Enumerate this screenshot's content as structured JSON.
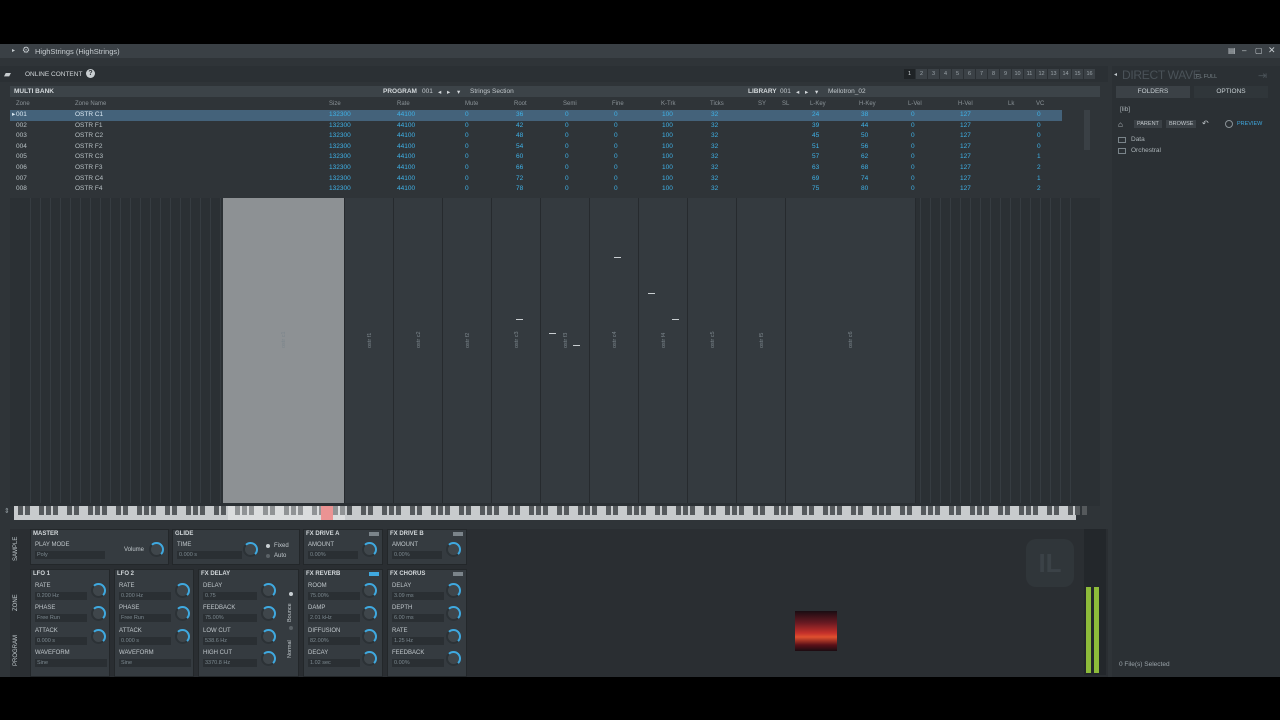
{
  "window": {
    "title": "HighStrings (HighStrings)"
  },
  "topbar": {
    "online_content": "ONLINE CONTENT",
    "tabs": [
      "1",
      "2",
      "3",
      "4",
      "5",
      "6",
      "7",
      "8",
      "9",
      "10",
      "11",
      "12",
      "13",
      "14",
      "15",
      "16"
    ]
  },
  "header": {
    "multi_bank": "MULTI BANK",
    "program_label": "PROGRAM",
    "program_num": "001",
    "program_name": "Strings Section",
    "library_label": "LIBRARY",
    "library_num": "001",
    "library_name": "Mellotron_02"
  },
  "columns": [
    "Zone",
    "Zone Name",
    "Size",
    "Rate",
    "Mute",
    "Root",
    "Semi",
    "Fine",
    "K-Trk",
    "Ticks",
    "SY",
    "SL",
    "L-Key",
    "H-Key",
    "L-Vel",
    "H-Vel",
    "Lk",
    "VC"
  ],
  "zones": [
    {
      "zone": "001",
      "name": "OSTR C1",
      "size": "132300",
      "rate": "44100",
      "mute": "0",
      "root": "36",
      "semi": "0",
      "fine": "0",
      "ktrk": "100",
      "ticks": "32",
      "lkey": "24",
      "hkey": "38",
      "lvel": "0",
      "hvel": "127",
      "vc": "0"
    },
    {
      "zone": "002",
      "name": "OSTR F1",
      "size": "132300",
      "rate": "44100",
      "mute": "0",
      "root": "42",
      "semi": "0",
      "fine": "0",
      "ktrk": "100",
      "ticks": "32",
      "lkey": "39",
      "hkey": "44",
      "lvel": "0",
      "hvel": "127",
      "vc": "0"
    },
    {
      "zone": "003",
      "name": "OSTR C2",
      "size": "132300",
      "rate": "44100",
      "mute": "0",
      "root": "48",
      "semi": "0",
      "fine": "0",
      "ktrk": "100",
      "ticks": "32",
      "lkey": "45",
      "hkey": "50",
      "lvel": "0",
      "hvel": "127",
      "vc": "0"
    },
    {
      "zone": "004",
      "name": "OSTR F2",
      "size": "132300",
      "rate": "44100",
      "mute": "0",
      "root": "54",
      "semi": "0",
      "fine": "0",
      "ktrk": "100",
      "ticks": "32",
      "lkey": "51",
      "hkey": "56",
      "lvel": "0",
      "hvel": "127",
      "vc": "0"
    },
    {
      "zone": "005",
      "name": "OSTR C3",
      "size": "132300",
      "rate": "44100",
      "mute": "0",
      "root": "60",
      "semi": "0",
      "fine": "0",
      "ktrk": "100",
      "ticks": "32",
      "lkey": "57",
      "hkey": "62",
      "lvel": "0",
      "hvel": "127",
      "vc": "1"
    },
    {
      "zone": "006",
      "name": "OSTR F3",
      "size": "132300",
      "rate": "44100",
      "mute": "0",
      "root": "66",
      "semi": "0",
      "fine": "0",
      "ktrk": "100",
      "ticks": "32",
      "lkey": "63",
      "hkey": "68",
      "lvel": "0",
      "hvel": "127",
      "vc": "2"
    },
    {
      "zone": "007",
      "name": "OSTR C4",
      "size": "132300",
      "rate": "44100",
      "mute": "0",
      "root": "72",
      "semi": "0",
      "fine": "0",
      "ktrk": "100",
      "ticks": "32",
      "lkey": "69",
      "hkey": "74",
      "lvel": "0",
      "hvel": "127",
      "vc": "1"
    },
    {
      "zone": "008",
      "name": "OSTR F4",
      "size": "132300",
      "rate": "44100",
      "mute": "0",
      "root": "78",
      "semi": "0",
      "fine": "0",
      "ktrk": "100",
      "ticks": "32",
      "lkey": "75",
      "hkey": "80",
      "lvel": "0",
      "hvel": "127",
      "vc": "2"
    }
  ],
  "zonemap_labels": [
    "ostr c1",
    "ostr f1",
    "ostr c2",
    "ostr f2",
    "ostr c3",
    "ostr f3",
    "ostr c4",
    "ostr f4",
    "ostr c5",
    "ostr f5",
    "ostr c6"
  ],
  "vtabs": [
    "SAMPLE",
    "ZONE",
    "PROGRAM"
  ],
  "master": {
    "title": "MASTER",
    "play_mode": "PLAY MODE",
    "play_mode_val": "Poly",
    "volume": "Volume"
  },
  "glide": {
    "title": "GLIDE",
    "time": "TIME",
    "time_val": "0.000 s",
    "fixed": "Fixed",
    "auto": "Auto"
  },
  "drive_a": {
    "title": "FX DRIVE A",
    "amount": "AMOUNT",
    "amount_val": "0.00%"
  },
  "drive_b": {
    "title": "FX DRIVE B",
    "amount": "AMOUNT",
    "amount_val": "0.00%"
  },
  "lfo1": {
    "title": "LFO 1",
    "rate": "RATE",
    "rate_val": "0.200 Hz",
    "phase": "PHASE",
    "phase_val": "Free Run",
    "attack": "ATTACK",
    "attack_val": "0.000 s",
    "waveform": "WAVEFORM",
    "waveform_val": "Sine"
  },
  "lfo2": {
    "title": "LFO 2",
    "rate": "RATE",
    "rate_val": "0.200 Hz",
    "phase": "PHASE",
    "phase_val": "Free Run",
    "attack": "ATTACK",
    "attack_val": "0.000 s",
    "waveform": "WAVEFORM",
    "waveform_val": "Sine"
  },
  "delay": {
    "title": "FX DELAY",
    "delay": "DELAY",
    "delay_val": "0.75",
    "feedback": "FEEDBACK",
    "feedback_val": "75.00%",
    "lowcut": "LOW CUT",
    "lowcut_val": "538.6 Hz",
    "highcut": "HIGH CUT",
    "highcut_val": "3370.8 Hz",
    "bounce": "Bounce",
    "normal": "Normal"
  },
  "reverb": {
    "title": "FX REVERB",
    "room": "ROOM",
    "room_val": "75.00%",
    "damp": "DAMP",
    "damp_val": "2.01 kHz",
    "diffusion": "DIFFUSION",
    "diffusion_val": "82.00%",
    "decay": "DECAY",
    "decay_val": "1.02 sec"
  },
  "chorus": {
    "title": "FX CHORUS",
    "delay": "DELAY",
    "delay_val": "3.09 ms",
    "depth": "DEPTH",
    "depth_val": "6.00 ms",
    "rate": "RATE",
    "rate_val": "1.25 Hz",
    "feedback": "FEEDBACK",
    "feedback_val": "0.00%"
  },
  "sidebar": {
    "brand": "DIRECT WAVE",
    "brand_sub": "FL FULL",
    "tab_folders": "FOLDERS",
    "tab_options": "OPTIONS",
    "path": "[lib]",
    "parent": "PARENT",
    "browse": "BROWSE",
    "preview": "PREVIEW",
    "folders": [
      "Data",
      "Orchestral"
    ],
    "status": "0 File(s) Selected"
  },
  "colors": {
    "accent": "#3fa9e0",
    "selected_row": "#44627a",
    "meter": "#8dbb3a",
    "bg": "#2f3438"
  }
}
